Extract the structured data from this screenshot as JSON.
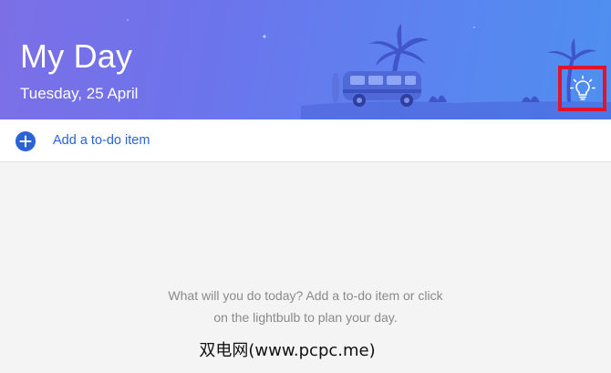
{
  "header": {
    "title": "My Day",
    "date": "Tuesday, 25 April",
    "suggestions_icon": "lightbulb-icon"
  },
  "add_item": {
    "icon": "plus-circle-icon",
    "label": "Add a to-do item"
  },
  "empty_state": {
    "line1": "What will you do today? Add a to-do item or click",
    "line2": "on the lightbulb to plan your day."
  },
  "watermark": "双电网(www.pcpc.me)",
  "colors": {
    "header_start": "#7c6fe6",
    "header_end": "#4e8ff0",
    "accent": "#2b63d6",
    "highlight_box": "#e0142a",
    "background": "#f4f4f4"
  }
}
